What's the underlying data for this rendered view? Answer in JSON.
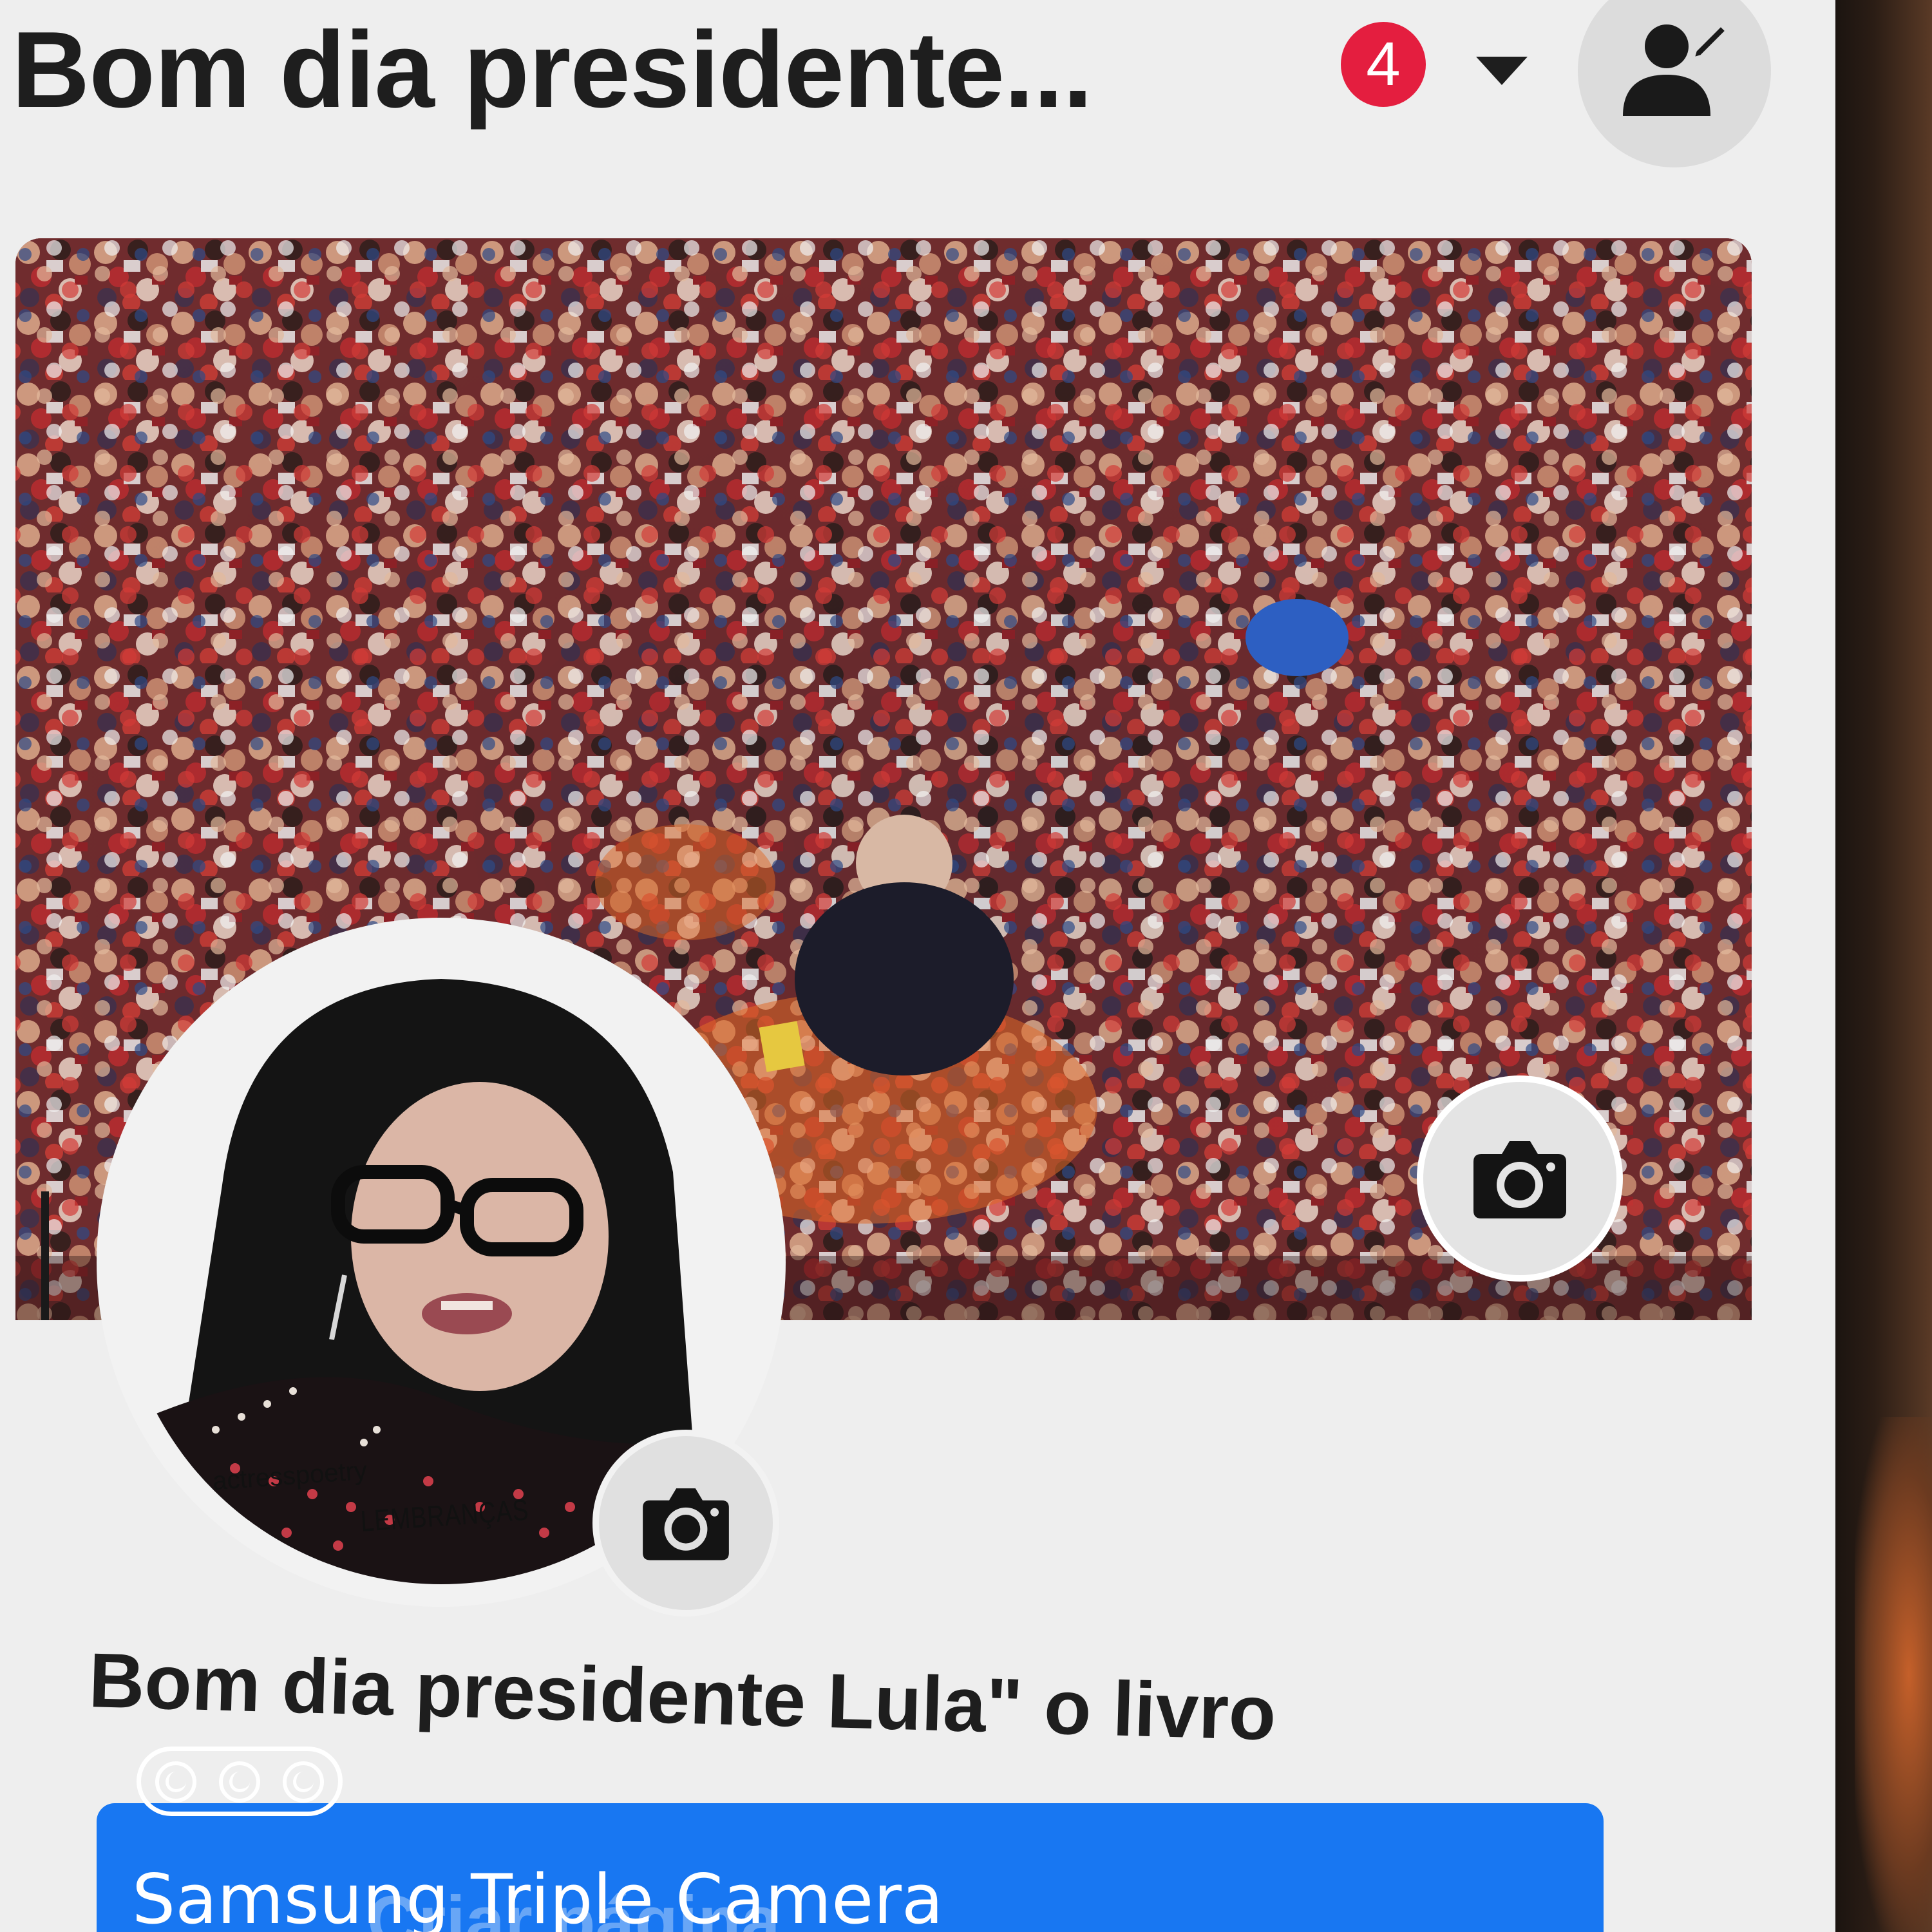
{
  "header": {
    "title": "Bom dia presidente...",
    "notification_count": "4",
    "dropdown_icon": "caret-down-icon",
    "profile_edit_icon": "user-edit-icon"
  },
  "cover": {
    "camera_icon": "camera-icon"
  },
  "profile": {
    "picture_watermark": "actresspoetry",
    "picture_caption": "LEMBRANÇAS",
    "camera_icon": "camera-icon",
    "name": "Bom dia presidente Lula\" o livro"
  },
  "action_button": {
    "label": "Criar página"
  },
  "camera_watermark": {
    "text": "Samsung Triple Camera",
    "icon": "triple-lens-icon"
  },
  "colors": {
    "badge": "#e41e3f",
    "primary": "#1877f2",
    "text": "#1e1e1e"
  }
}
